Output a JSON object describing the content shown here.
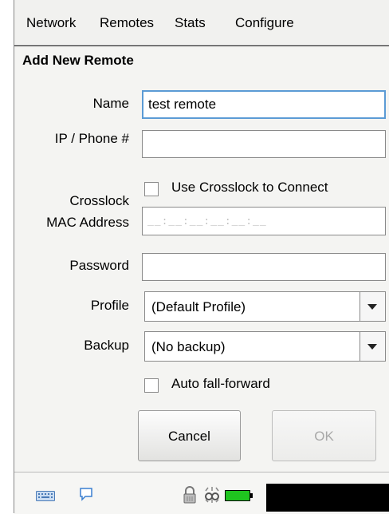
{
  "menu": {
    "items": [
      {
        "label": "Network"
      },
      {
        "label": "Remotes"
      },
      {
        "label": "Stats"
      },
      {
        "label": "Configure"
      }
    ]
  },
  "dialog": {
    "title": "Add New Remote",
    "name_label": "Name",
    "name_value": "test remote",
    "ip_label": "IP / Phone #",
    "ip_value": "",
    "crosslock_label": "Crosslock",
    "crosslock_checkbox_label": "Use Crosslock to Connect",
    "crosslock_checked": false,
    "mac_label": "MAC Address",
    "mac_mask": "__:__:__:__:__:__",
    "password_label": "Password",
    "password_value": "",
    "profile_label": "Profile",
    "profile_value": "(Default Profile)",
    "backup_label": "Backup",
    "backup_value": "(No backup)",
    "auto_fall_forward_label": "Auto fall-forward",
    "auto_fall_forward_checked": false,
    "cancel_label": "Cancel",
    "ok_label": "OK"
  },
  "statusbar": {
    "icons": [
      "keyboard-icon",
      "chat-bubble-icon",
      "lock-icon",
      "connection-icon",
      "battery-icon"
    ],
    "battery_color": "#1fc41f"
  },
  "colors": {
    "focus_border": "#5b9bd5",
    "background": "#f1f1ef"
  }
}
